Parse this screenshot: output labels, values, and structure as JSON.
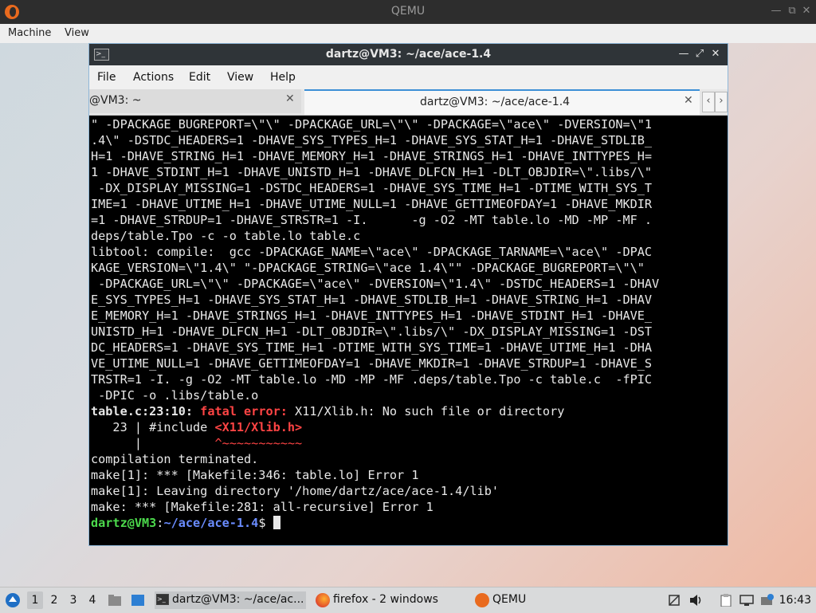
{
  "qemu": {
    "title": "QEMU",
    "menu": [
      "Machine",
      "View"
    ]
  },
  "terminal": {
    "window_title": "dartz@VM3: ~/ace/ace-1.4",
    "menu": [
      "File",
      "Actions",
      "Edit",
      "View",
      "Help"
    ],
    "tabs": [
      {
        "label": "@VM3: ~",
        "active": false
      },
      {
        "label": "dartz@VM3: ~/ace/ace-1.4",
        "active": true
      }
    ],
    "lines": [
      "\" -DPACKAGE_BUGREPORT=\\\"\\\" -DPACKAGE_URL=\\\"\\\" -DPACKAGE=\\\"ace\\\" -DVERSION=\\\"1",
      ".4\\\" -DSTDC_HEADERS=1 -DHAVE_SYS_TYPES_H=1 -DHAVE_SYS_STAT_H=1 -DHAVE_STDLIB_",
      "H=1 -DHAVE_STRING_H=1 -DHAVE_MEMORY_H=1 -DHAVE_STRINGS_H=1 -DHAVE_INTTYPES_H=",
      "1 -DHAVE_STDINT_H=1 -DHAVE_UNISTD_H=1 -DHAVE_DLFCN_H=1 -DLT_OBJDIR=\\\".libs/\\\"",
      " -DX_DISPLAY_MISSING=1 -DSTDC_HEADERS=1 -DHAVE_SYS_TIME_H=1 -DTIME_WITH_SYS_T",
      "IME=1 -DHAVE_UTIME_H=1 -DHAVE_UTIME_NULL=1 -DHAVE_GETTIMEOFDAY=1 -DHAVE_MKDIR",
      "=1 -DHAVE_STRDUP=1 -DHAVE_STRSTR=1 -I.      -g -O2 -MT table.lo -MD -MP -MF .",
      "deps/table.Tpo -c -o table.lo table.c",
      "libtool: compile:  gcc -DPACKAGE_NAME=\\\"ace\\\" -DPACKAGE_TARNAME=\\\"ace\\\" -DPAC",
      "KAGE_VERSION=\\\"1.4\\\" \"-DPACKAGE_STRING=\\\"ace 1.4\\\"\" -DPACKAGE_BUGREPORT=\\\"\\\"",
      " -DPACKAGE_URL=\\\"\\\" -DPACKAGE=\\\"ace\\\" -DVERSION=\\\"1.4\\\" -DSTDC_HEADERS=1 -DHAV",
      "E_SYS_TYPES_H=1 -DHAVE_SYS_STAT_H=1 -DHAVE_STDLIB_H=1 -DHAVE_STRING_H=1 -DHAV",
      "E_MEMORY_H=1 -DHAVE_STRINGS_H=1 -DHAVE_INTTYPES_H=1 -DHAVE_STDINT_H=1 -DHAVE_",
      "UNISTD_H=1 -DHAVE_DLFCN_H=1 -DLT_OBJDIR=\\\".libs/\\\" -DX_DISPLAY_MISSING=1 -DST",
      "DC_HEADERS=1 -DHAVE_SYS_TIME_H=1 -DTIME_WITH_SYS_TIME=1 -DHAVE_UTIME_H=1 -DHA",
      "VE_UTIME_NULL=1 -DHAVE_GETTIMEOFDAY=1 -DHAVE_MKDIR=1 -DHAVE_STRDUP=1 -DHAVE_S",
      "TRSTR=1 -I. -g -O2 -MT table.lo -MD -MP -MF .deps/table.Tpo -c table.c  -fPIC",
      " -DPIC -o .libs/table.o"
    ],
    "error": {
      "location": "table.c:23:10:",
      "kind": "fatal error:",
      "message": " X11/Xlib.h: No such file or directory",
      "src_prefix": "   23 | #include ",
      "src_highlight": "<X11/Xlib.h>",
      "caret_prefix": "      |          ",
      "caret": "^~~~~~~~~~~~"
    },
    "after_lines": [
      "compilation terminated.",
      "make[1]: *** [Makefile:346: table.lo] Error 1",
      "make[1]: Leaving directory '/home/dartz/ace/ace-1.4/lib'",
      "make: *** [Makefile:281: all-recursive] Error 1"
    ],
    "prompt": {
      "user": "dartz@VM3",
      "sep": ":",
      "path": "~/ace/ace-1.4",
      "symbol": "$ "
    }
  },
  "taskbar": {
    "workspaces": [
      "1",
      "2",
      "3",
      "4"
    ],
    "tasks": [
      {
        "label": "dartz@VM3: ~/ace/ac..."
      },
      {
        "label": "firefox - 2 windows"
      },
      {
        "label": "QEMU"
      }
    ],
    "clock": "16:43"
  },
  "colors": {
    "terminal_bg": "#000000",
    "terminal_fg": "#e8e8e8",
    "error_red": "#ff4444",
    "prompt_green": "#4cd94c",
    "prompt_blue": "#6a8cff",
    "tab_accent": "#3d8fd6"
  }
}
